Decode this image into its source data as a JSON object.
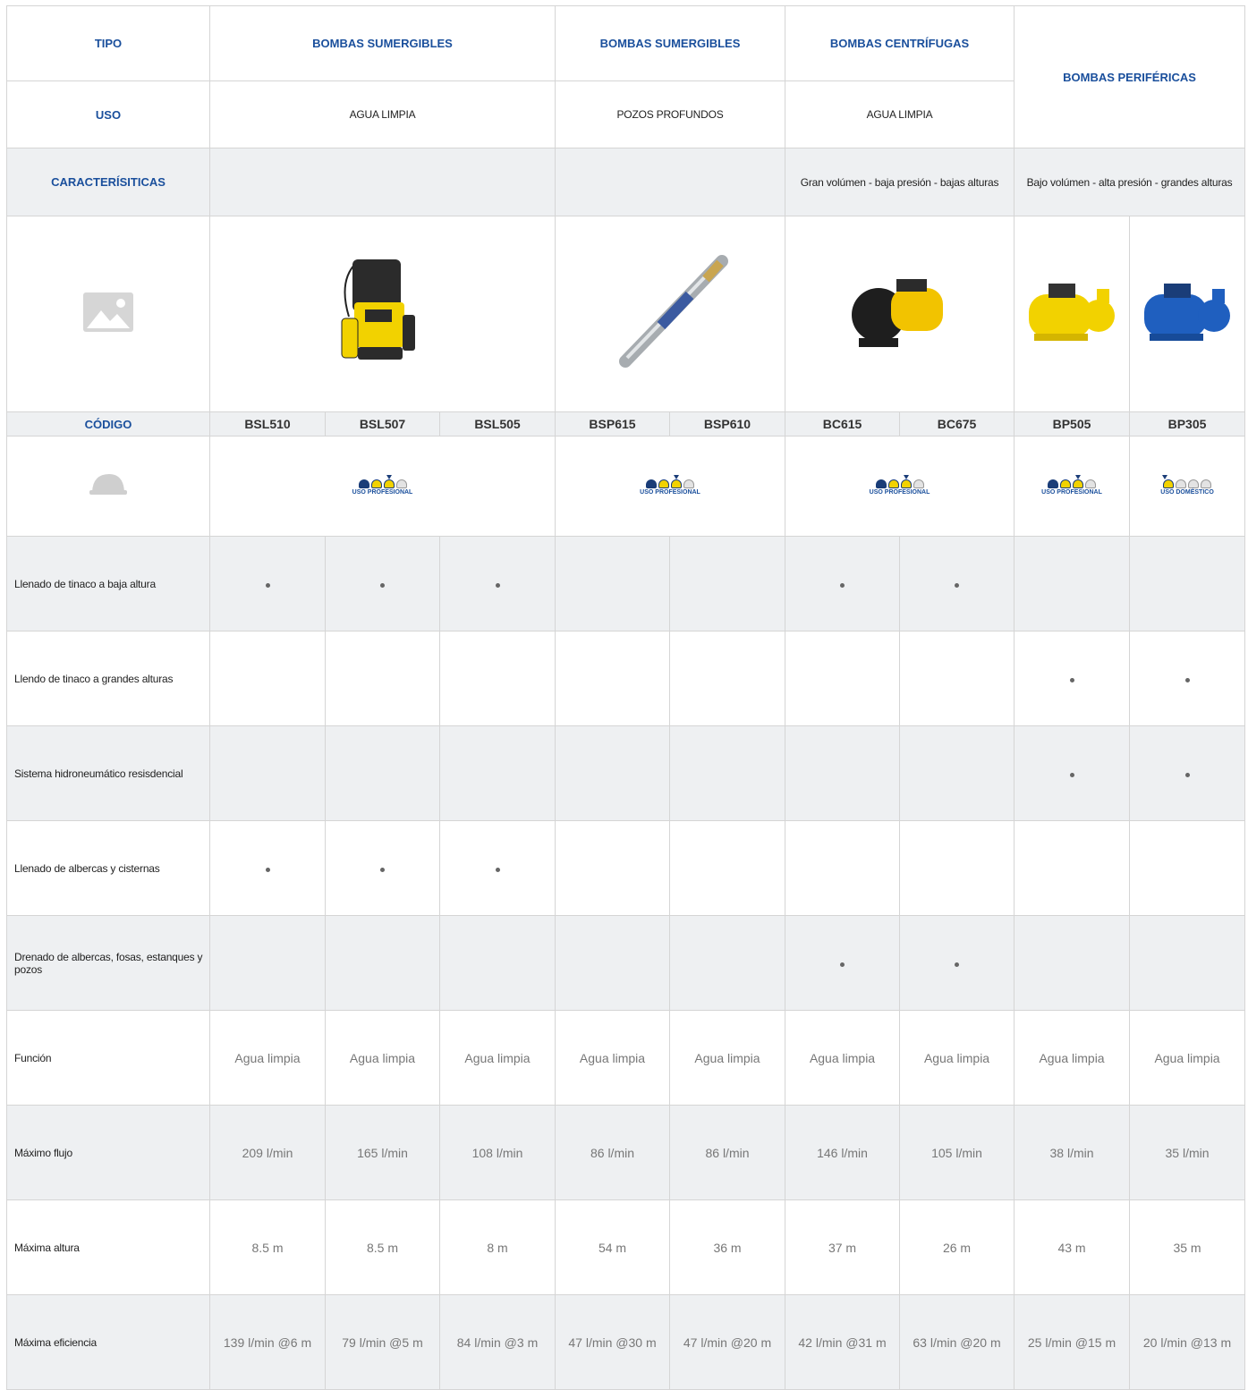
{
  "header": {
    "tipo_label": "TIPO",
    "uso_label": "USO",
    "caract_label": "CARACTERÍSITICAS",
    "codigo_label": "CÓDIGO",
    "tipos": [
      "BOMBAS SUMERGIBLES",
      "BOMBAS SUMERGIBLES",
      "BOMBAS CENTRÍFUGAS",
      "BOMBAS PERIFÉRICAS"
    ],
    "usos": [
      "AGUA LIMPIA",
      "POZOS PROFUNDOS",
      "AGUA LIMPIA"
    ],
    "caracteristicas": [
      "Gran volúmen - baja presión - bajas alturas",
      "Bajo volúmen - alta presión - grandes alturas"
    ]
  },
  "codes": [
    "BSL510",
    "BSL507",
    "BSL505",
    "BSP615",
    "BSP610",
    "BC615",
    "BC675",
    "BP505",
    "BP305"
  ],
  "badges": {
    "profesional": "USO PROFESIONAL",
    "domestico": "USO DOMÉSTICO"
  },
  "features": [
    {
      "label": "Llenado de tinaco a baja altura",
      "marks": [
        1,
        1,
        1,
        0,
        0,
        1,
        1,
        0,
        0
      ]
    },
    {
      "label": "Llendo de tinaco a grandes alturas",
      "marks": [
        0,
        0,
        0,
        0,
        0,
        0,
        0,
        1,
        1
      ]
    },
    {
      "label": "Sistema hidroneumático resisdencial",
      "marks": [
        0,
        0,
        0,
        0,
        0,
        0,
        0,
        1,
        1
      ]
    },
    {
      "label": "Llenado de albercas y cisternas",
      "marks": [
        1,
        1,
        1,
        0,
        0,
        0,
        0,
        0,
        0
      ]
    },
    {
      "label": "Drenado de albercas, fosas, estanques y pozos",
      "marks": [
        0,
        0,
        0,
        0,
        0,
        1,
        1,
        0,
        0
      ]
    }
  ],
  "specs": [
    {
      "label": "Función",
      "values": [
        "Agua limpia",
        "Agua limpia",
        "Agua limpia",
        "Agua limpia",
        "Agua limpia",
        "Agua limpia",
        "Agua limpia",
        "Agua limpia",
        "Agua limpia"
      ]
    },
    {
      "label": "Máximo flujo",
      "values": [
        "209 l/min",
        "165 l/min",
        "108 l/min",
        "86 l/min",
        "86 l/min",
        "146 l/min",
        "105 l/min",
        "38 l/min",
        "35 l/min"
      ]
    },
    {
      "label": "Máxima altura",
      "values": [
        "8.5 m",
        "8.5 m",
        "8 m",
        "54 m",
        "36 m",
        "37 m",
        "26 m",
        "43 m",
        "35 m"
      ]
    },
    {
      "label": "Máxima eficiencia",
      "values": [
        "139 l/min @6 m",
        "79 l/min @5 m",
        "84 l/min @3 m",
        "47 l/min @30 m",
        "47 l/min @20 m",
        "42 l/min @31 m",
        "63 l/min @20 m",
        "25 l/min @15 m",
        "20 l/min @13 m"
      ]
    }
  ],
  "colors": {
    "accent": "#1a4f9c",
    "yellow": "#f2d200",
    "row_gray": "#eef0f2"
  }
}
